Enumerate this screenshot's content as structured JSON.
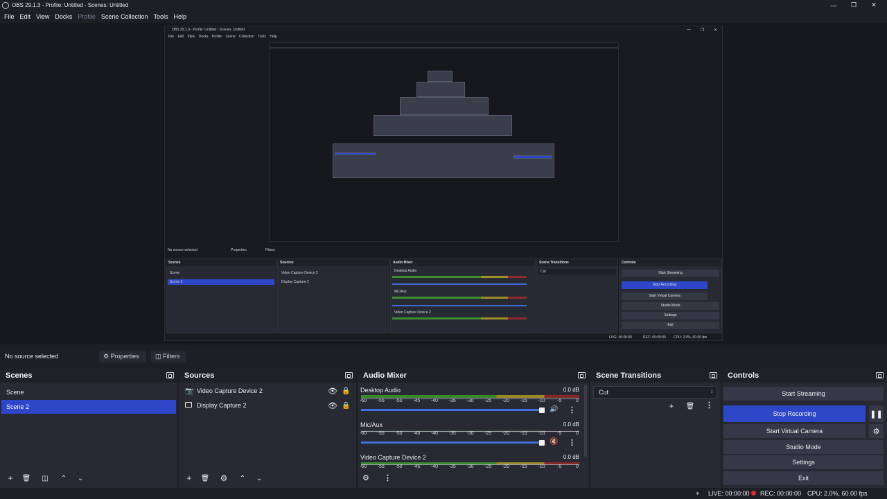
{
  "window": {
    "title": "OBS 29.1.3 - Profile: Untitled - Scenes: Untitled"
  },
  "menu": [
    "File",
    "Edit",
    "View",
    "Docks",
    "Profile",
    "Scene Collection",
    "Tools",
    "Help"
  ],
  "preview_shot": {
    "title": "OBS 29.1.3 - Profile: Untitled - Scenes: Untitled",
    "menu": "File Edit View Docks Profile Scene Collection Tools Help",
    "source_bar": {
      "label": "No source selected",
      "properties": "Properties",
      "filters": "Filters"
    },
    "scenes": {
      "header": "Scenes",
      "items": [
        "Scene",
        "Scene 2"
      ]
    },
    "sources": {
      "header": "Sources",
      "items": [
        "Video Capture Device 2",
        "Display Capture 2"
      ]
    },
    "mixer": {
      "header": "Audio Mixer",
      "channels": [
        {
          "name": "Desktop Audio",
          "db": "0.0 dB"
        },
        {
          "name": "Mic/Aux",
          "db": "0.0 dB"
        },
        {
          "name": "Video Capture Device 2",
          "db": "0.0 dB"
        }
      ]
    },
    "transitions": {
      "header": "Scene Transitions",
      "value": "Cut"
    },
    "controls": {
      "header": "Controls",
      "buttons": [
        "Start Streaming",
        "Stop Recording",
        "Start Virtual Camera",
        "Studio Mode",
        "Settings",
        "Exit"
      ]
    },
    "status": {
      "live": "LIVE: 00:00:00",
      "rec": "REC: 00:00:00",
      "cpu": "CPU: 2.0%, 60.00 fps"
    }
  },
  "source_bar": {
    "label": "No source selected",
    "properties": "Properties",
    "filters": "Filters"
  },
  "scenes": {
    "header": "Scenes",
    "items": [
      {
        "label": "Scene"
      },
      {
        "label": "Scene 2"
      }
    ]
  },
  "sources": {
    "header": "Sources",
    "items": [
      {
        "label": "Video Capture Device 2",
        "icon": "camera-icon"
      },
      {
        "label": "Display Capture 2",
        "icon": "monitor-icon"
      }
    ]
  },
  "mixer": {
    "header": "Audio Mixer",
    "scale": [
      "-60",
      "-55",
      "-50",
      "-45",
      "-40",
      "-35",
      "-30",
      "-25",
      "-20",
      "-15",
      "-10",
      "-5",
      "0"
    ],
    "channels": [
      {
        "name": "Desktop Audio",
        "db": "0.0 dB",
        "volume": 0.87
      },
      {
        "name": "Mic/Aux",
        "db": "0.0 dB",
        "volume": 0.87
      },
      {
        "name": "Video Capture Device 2",
        "db": "0.0 dB",
        "volume": 0.87
      }
    ]
  },
  "transitions": {
    "header": "Scene Transitions",
    "value": "Cut"
  },
  "controls": {
    "header": "Controls",
    "start_streaming": "Start Streaming",
    "stop_recording": "Stop Recording",
    "start_virtual_camera": "Start Virtual Camera",
    "studio_mode": "Studio Mode",
    "settings": "Settings",
    "exit": "Exit"
  },
  "status": {
    "live": "LIVE: 00:00:00",
    "rec": "REC: 00:00:00",
    "cpu": "CPU: 2.0%, 60.00 fps"
  },
  "colors": {
    "accent": "#2e47c9",
    "record": "#e12b2b",
    "panel": "#272a33",
    "background": "#1d1f26"
  }
}
